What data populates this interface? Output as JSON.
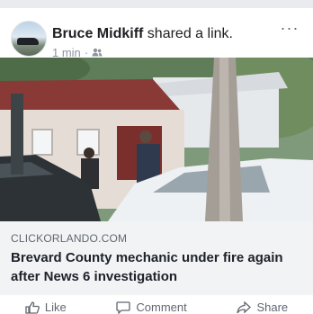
{
  "post": {
    "author": "Bruce Midkiff",
    "action_text": "shared a link.",
    "time": "1 min",
    "separator": "·",
    "audience_icon": "friends-icon",
    "more_label": "···"
  },
  "link": {
    "domain": "CLICKORLANDO.COM",
    "headline": "Brevard County mechanic under fire again after News 6 investigation"
  },
  "actions": {
    "like": "Like",
    "comment": "Comment",
    "share": "Share"
  },
  "colors": {
    "name_text": "#1c1e21",
    "meta_text": "#8d949e",
    "link_footer_bg": "#f2f3f5"
  }
}
